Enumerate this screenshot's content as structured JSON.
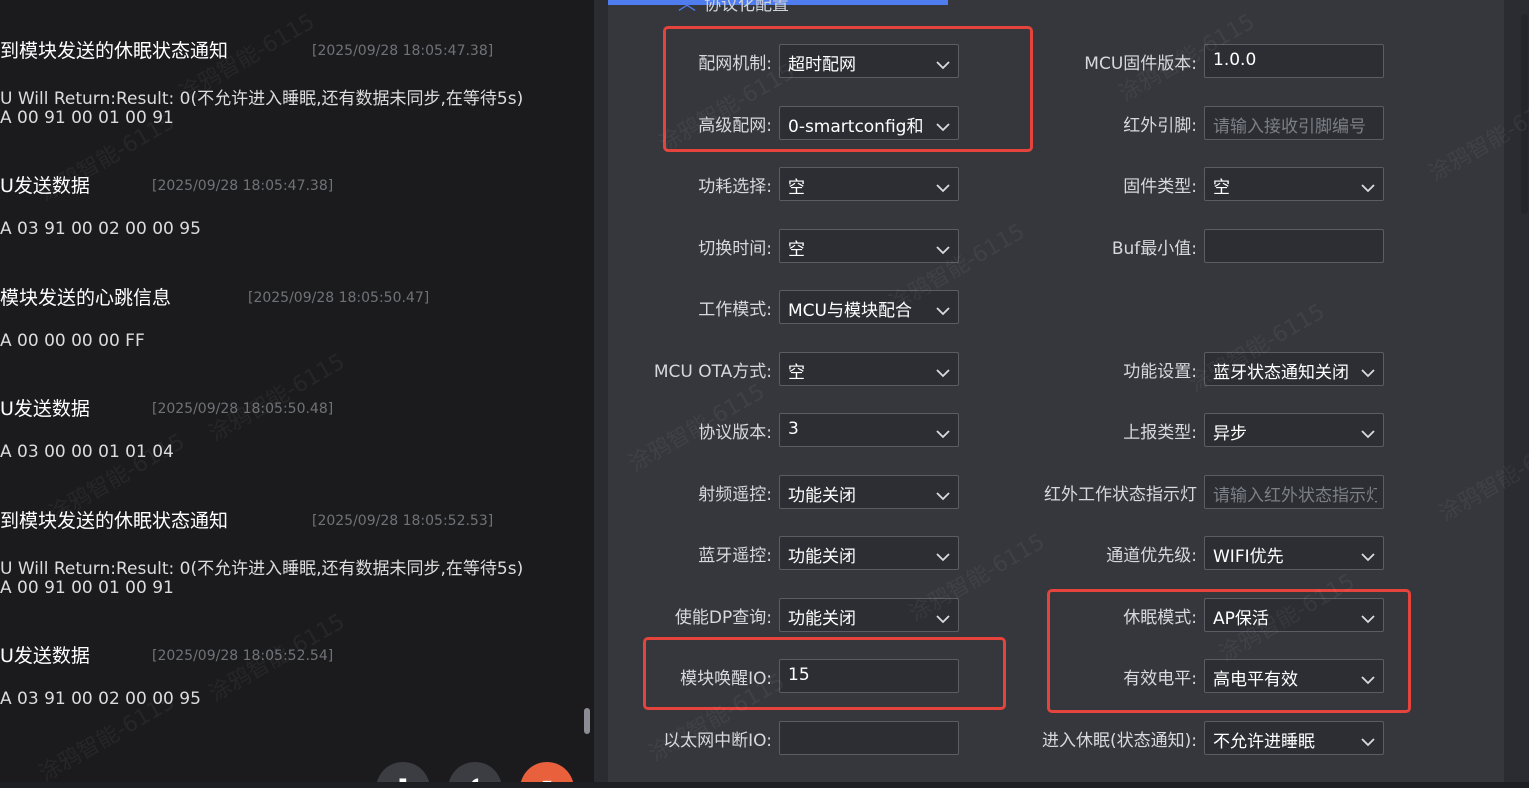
{
  "log": {
    "entries": [
      {
        "title": "到模块发送的休眠状态通知",
        "time": "[2025/09/28 18:05:47.38]",
        "lines": [
          "U Will Return:Result: 0(不允许进入睡眠,还有数据未同步,在等待5s)",
          "A 00 91 00 01 00 91"
        ]
      },
      {
        "title": "U发送数据",
        "time": "[2025/09/28 18:05:47.38]",
        "lines": [
          "A 03 91 00 02 00 00 95"
        ]
      },
      {
        "title": "模块发送的心跳信息",
        "time": "[2025/09/28 18:05:50.47]",
        "lines": [
          "A 00 00 00 00 FF"
        ]
      },
      {
        "title": "U发送数据",
        "time": "[2025/09/28 18:05:50.48]",
        "lines": [
          "A 03 00 00 01 01 04"
        ]
      },
      {
        "title": "到模块发送的休眠状态通知",
        "time": "[2025/09/28 18:05:52.53]",
        "lines": [
          "U Will Return:Result: 0(不允许进入睡眠,还有数据未同步,在等待5s)",
          "A 00 91 00 01 00 91"
        ]
      },
      {
        "title": "U发送数据",
        "time": "[2025/09/28 18:05:52.54]",
        "lines": [
          "A 03 91 00 02 00 00 95"
        ]
      }
    ]
  },
  "config": {
    "section_title": "协议化配置",
    "left_fields": [
      {
        "label": "配网机制:",
        "value": "超时配网",
        "type": "select"
      },
      {
        "label": "高级配网:",
        "value": "0-smartconfig和",
        "type": "select"
      },
      {
        "label": "功耗选择:",
        "value": "空",
        "type": "select"
      },
      {
        "label": "切换时间:",
        "value": "空",
        "type": "select"
      },
      {
        "label": "工作模式:",
        "value": "MCU与模块配合",
        "type": "select"
      },
      {
        "label": "MCU OTA方式:",
        "value": "空",
        "type": "select"
      },
      {
        "label": "协议版本:",
        "value": "3",
        "type": "select"
      },
      {
        "label": "射频遥控:",
        "value": "功能关闭",
        "type": "select"
      },
      {
        "label": "蓝牙遥控:",
        "value": "功能关闭",
        "type": "select"
      },
      {
        "label": "使能DP查询:",
        "value": "功能关闭",
        "type": "select"
      },
      {
        "label": "模块唤醒IO:",
        "value": "15",
        "type": "input"
      },
      {
        "label": "以太网中断IO:",
        "value": "",
        "type": "input"
      }
    ],
    "right_fields": [
      {
        "label": "MCU固件版本:",
        "value": "1.0.0",
        "type": "input"
      },
      {
        "label": "红外引脚:",
        "value": "",
        "placeholder": "请输入接收引脚编号",
        "type": "input"
      },
      {
        "label": "固件类型:",
        "value": "空",
        "type": "select"
      },
      {
        "label": "Buf最小值:",
        "value": "",
        "type": "input"
      },
      {
        "label": "",
        "value": "",
        "type": "none"
      },
      {
        "label": "功能设置:",
        "value": "蓝牙状态通知关闭",
        "type": "select"
      },
      {
        "label": "上报类型:",
        "value": "异步",
        "type": "select"
      },
      {
        "label": "红外工作状态指示灯",
        "value": "",
        "placeholder": "请输入红外状态指示灯",
        "type": "input"
      },
      {
        "label": "通道优先级:",
        "value": "WIFI优先",
        "type": "select"
      },
      {
        "label": "休眠模式:",
        "value": "AP保活",
        "type": "select"
      },
      {
        "label": "有效电平:",
        "value": "高电平有效",
        "type": "select"
      },
      {
        "label": "进入休眠(状态通知):",
        "value": "不允许进睡眠",
        "type": "select"
      }
    ]
  },
  "watermark": "涂鸦智能-6115",
  "colors": {
    "highlight": "#e4443c",
    "accent": "#4f7df0",
    "fab": "#e8603c"
  },
  "icons": {
    "caret": "chevron-down-icon"
  }
}
